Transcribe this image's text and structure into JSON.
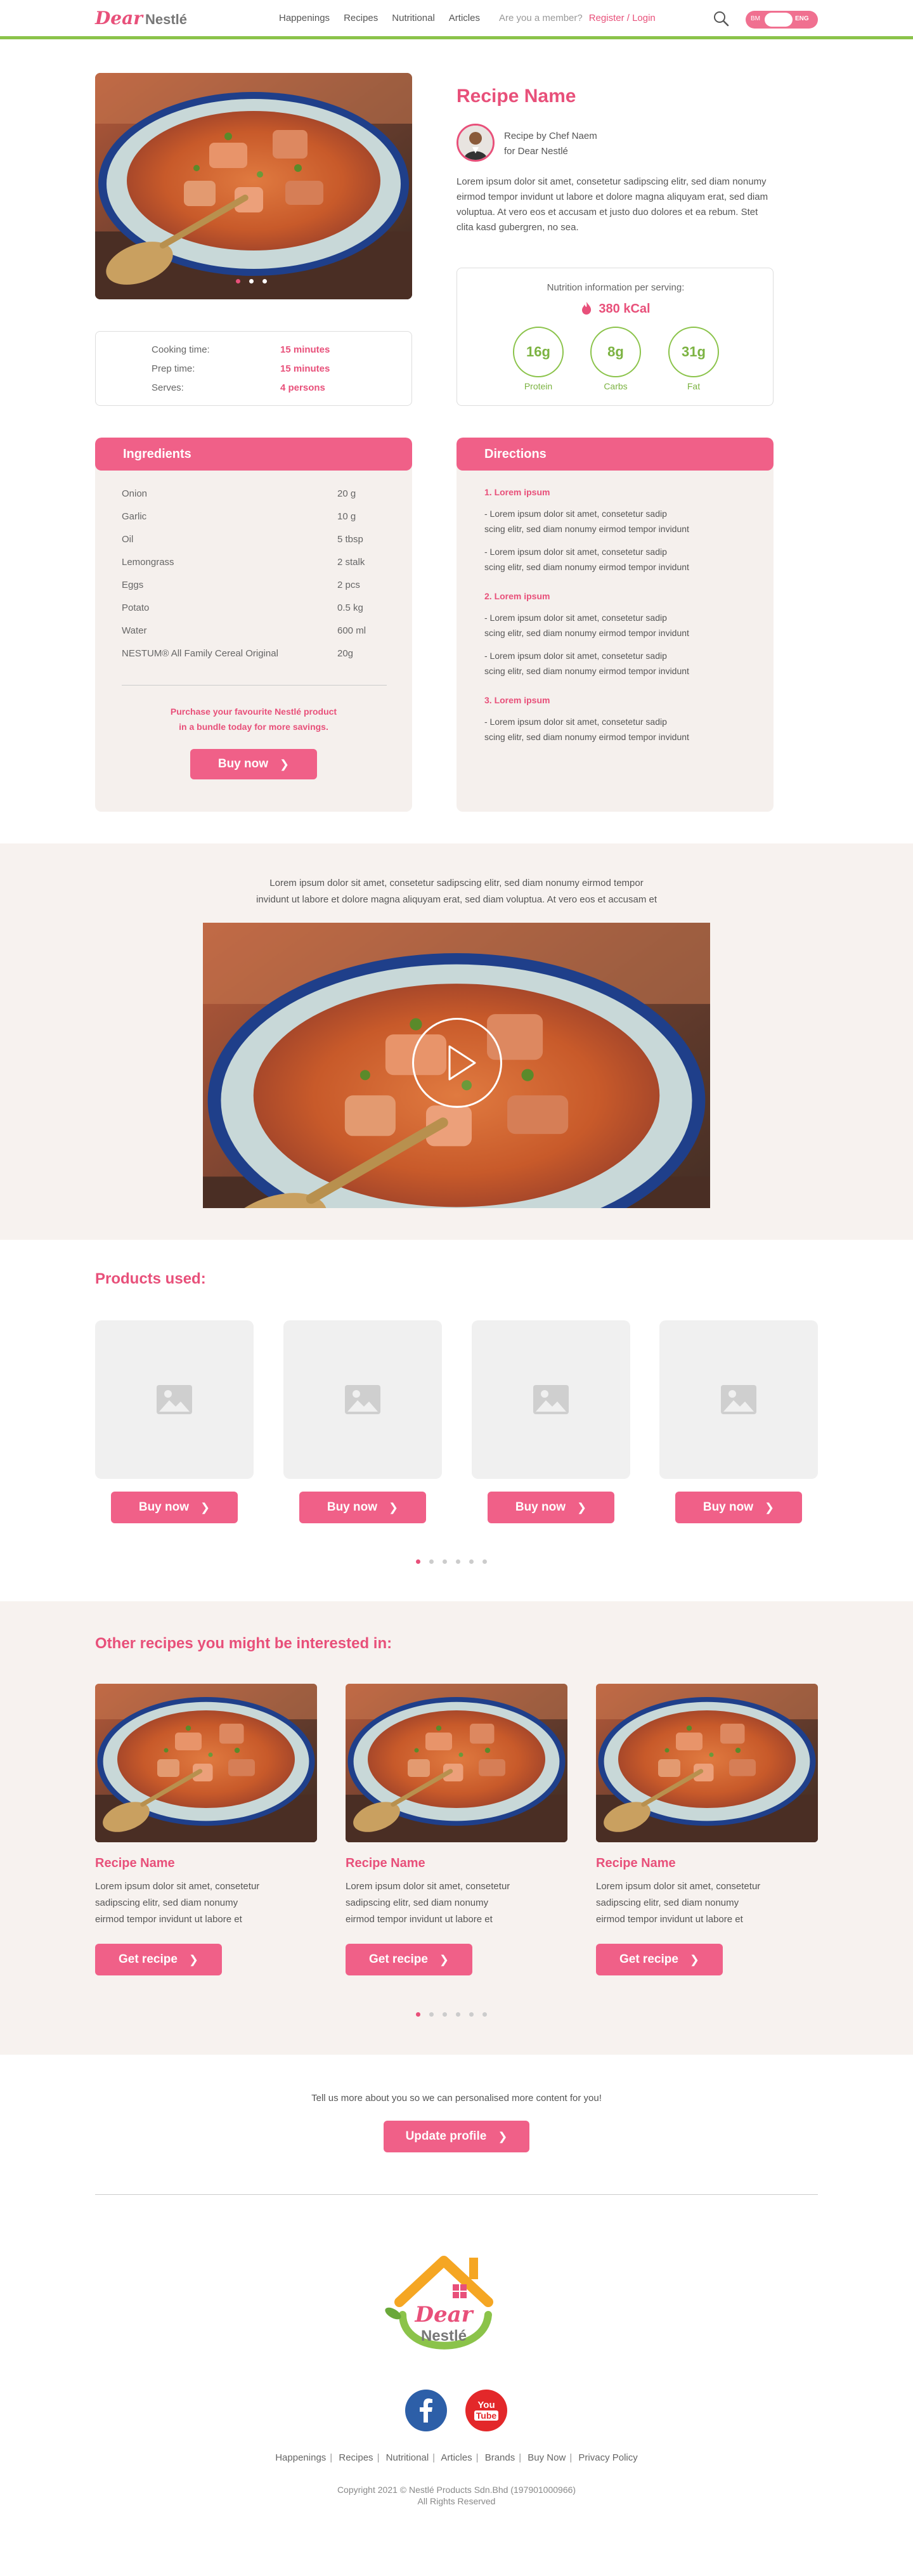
{
  "brand": {
    "logo_main": "Dear",
    "logo_sub": "Nestlé"
  },
  "nav": {
    "items": [
      "Happenings",
      "Recipes",
      "Nutritional",
      "Articles"
    ],
    "member_question": "Are you a member?",
    "login": "Register / Login",
    "lang_left": "BM",
    "lang_right": "ENG"
  },
  "recipe": {
    "title": "Recipe Name",
    "chef_line1": "Recipe by Chef Naem",
    "chef_line2": "for Dear Nestlé",
    "description": "Lorem ipsum dolor sit amet, consetetur sadipscing elitr, sed diam nonumy eirmod tempor invidunt ut labore et dolore magna aliquyam erat, sed diam voluptua. At vero eos et accusam et justo duo dolores et ea rebum. Stet clita kasd gubergren, no sea.",
    "cooking_time_label": "Cooking time:",
    "cooking_time": "15 minutes",
    "prep_time_label": "Prep time:",
    "prep_time": "15 minutes",
    "serves_label": "Serves:",
    "serves": "4 persons",
    "hero_slide_active": 1,
    "hero_slide_count": 3
  },
  "nutrition": {
    "title": "Nutrition information per serving:",
    "kcal": "380 kCal",
    "macros": [
      {
        "value": "16g",
        "label": "Protein"
      },
      {
        "value": "8g",
        "label": "Carbs"
      },
      {
        "value": "31g",
        "label": "Fat"
      }
    ]
  },
  "ingredients": {
    "heading": "Ingredients",
    "items": [
      {
        "name": "Onion",
        "qty": "20 g"
      },
      {
        "name": "Garlic",
        "qty": "10 g"
      },
      {
        "name": "Oil",
        "qty": "5 tbsp"
      },
      {
        "name": "Lemongrass",
        "qty": "2 stalk"
      },
      {
        "name": "Eggs",
        "qty": "2 pcs"
      },
      {
        "name": "Potato",
        "qty": "0.5 kg"
      },
      {
        "name": "Water",
        "qty": "600 ml"
      },
      {
        "name": "NESTUM® All Family Cereal Original",
        "qty": "20g"
      }
    ],
    "promo_line1": "Purchase your favourite Nestlé product",
    "promo_line2": "in a bundle today for more savings.",
    "buy_label": "Buy now"
  },
  "directions": {
    "heading": "Directions",
    "step1": "1. Lorem ipsum",
    "step2": "2. Lorem ipsum",
    "step3": "3. Lorem ipsum",
    "line1": "- Lorem ipsum dolor sit amet, consetetur sadip",
    "line2": "scing elitr, sed diam nonumy eirmod tempor invidunt"
  },
  "video": {
    "text_line1": "Lorem ipsum dolor sit amet, consetetur sadipscing elitr, sed diam nonumy eirmod tempor",
    "text_line2": "invidunt ut labore et dolore magna aliquyam erat, sed diam voluptua. At vero eos et accusam et"
  },
  "products": {
    "heading": "Products used:",
    "buy_label": "Buy now",
    "card_count": 4,
    "page_active": 1,
    "page_count": 6
  },
  "other_recipes": {
    "heading": "Other recipes you might be interested in:",
    "card_name": "Recipe Name",
    "card_desc_1": "Lorem ipsum dolor sit amet, consetetur",
    "card_desc_2": "sadipscing elitr, sed diam nonumy",
    "card_desc_3": "eirmod tempor invidunt ut labore et",
    "cta_label": "Get recipe",
    "page_active": 1,
    "page_count": 6
  },
  "profile": {
    "prompt": "Tell us more about you so we can personalised more content for you!",
    "button": "Update profile"
  },
  "footer": {
    "logo_main": "Dear",
    "logo_sub": "Nestlé",
    "links": [
      "Happenings",
      "Recipes",
      "Nutritional",
      "Articles",
      "Brands",
      "Buy Now",
      "Privacy Policy"
    ],
    "copyright": "Copyright 2021 © Nestlé Products Sdn.Bhd (197901000966)",
    "rights": "All Rights Reserved",
    "youtube_you": "You",
    "youtube_tube": "Tube"
  },
  "colors": {
    "accent": "#e8507a",
    "button": "#f06088",
    "green": "#8bc34a",
    "section_bg": "#f7f2ef"
  }
}
